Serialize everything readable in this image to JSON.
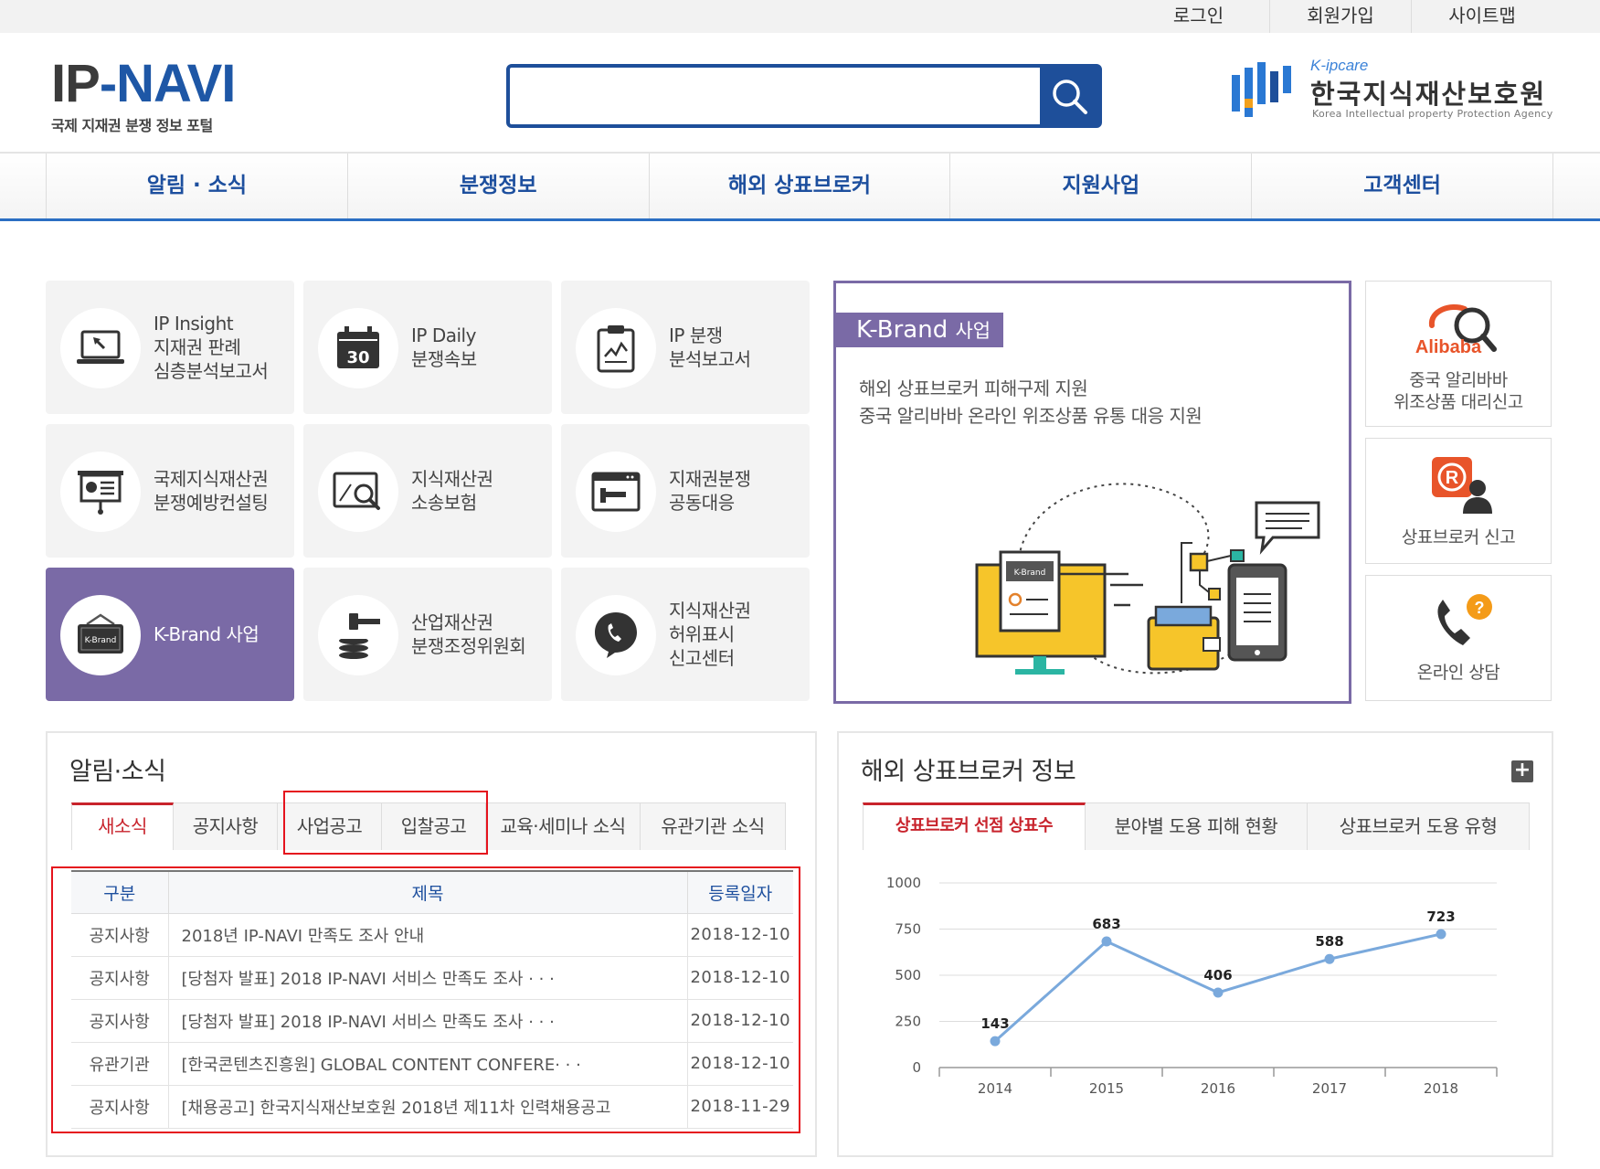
{
  "topbar": {
    "links": [
      "로그인",
      "회원가입",
      "사이트맵"
    ]
  },
  "logo": {
    "main_a": "IP",
    "main_b": "NAVI",
    "sub": "국제 지재권 분쟁 정보 포털"
  },
  "search": {
    "placeholder": "",
    "icon": "search-icon"
  },
  "agency": {
    "kip": "K-ipcare",
    "name": "한국지식재산보호원",
    "en": "Korea Intellectual property Protection Agency"
  },
  "nav": {
    "items": [
      "알림 · 소식",
      "분쟁정보",
      "해외 상표브로커",
      "지원사업",
      "고객센터"
    ]
  },
  "tiles": [
    {
      "label": "IP Insight\n지재권 판례\n심층분석보고서",
      "icon": "laptop-icon"
    },
    {
      "label": "IP Daily\n분쟁속보",
      "icon": "calendar-icon",
      "badge": "30"
    },
    {
      "label": "IP 분쟁\n분석보고서",
      "icon": "clipboard-chart-icon"
    },
    {
      "label": "국제지식재산권\n분쟁예방컨설팅",
      "icon": "presentation-board-icon"
    },
    {
      "label": "지식재산권\n소송보험",
      "icon": "magnifier-screen-icon"
    },
    {
      "label": "지재권분쟁\n공동대응",
      "icon": "browser-window-icon"
    },
    {
      "label": "K-Brand 사업",
      "icon": "k-brand-icon",
      "badge": "K-Brand",
      "active": true
    },
    {
      "label": "산업재산권\n분쟁조정위원회",
      "icon": "gavel-icon"
    },
    {
      "label": "지식재산권\n허위표시\n신고센터",
      "icon": "phone-bubble-icon"
    }
  ],
  "kbrand": {
    "title_a": "K-Brand",
    "title_b": "사업",
    "desc": "해외 상표브로커 피해구제 지원\n중국 알리바바 온라인 위조상품 유통 대응 지원",
    "illu_badge": "K-Brand"
  },
  "quick": [
    {
      "label": "중국 알리바바\n위조상품 대리신고",
      "icon": "alibaba-search-icon",
      "brand": "Alibaba"
    },
    {
      "label": "상표브로커 신고",
      "icon": "registered-person-icon"
    },
    {
      "label": "온라인 상담",
      "icon": "phone-question-icon"
    }
  ],
  "notices": {
    "title": "알림·소식",
    "tabs": [
      "새소식",
      "공지사항",
      "사업공고",
      "입찰공고",
      "교육·세미나 소식",
      "유관기관 소식"
    ],
    "active_tab": 0,
    "headers": [
      "구분",
      "제목",
      "등록일자"
    ],
    "rows": [
      {
        "cat": "공지사항",
        "title": "2018년 IP-NAVI 만족도 조사 안내",
        "date": "2018-12-10"
      },
      {
        "cat": "공지사항",
        "title": "[당첨자 발표] 2018 IP-NAVI 서비스 만족도 조사 · · ·",
        "date": "2018-12-10"
      },
      {
        "cat": "공지사항",
        "title": "[당첨자 발표] 2018 IP-NAVI 서비스 만족도 조사 · · ·",
        "date": "2018-12-10"
      },
      {
        "cat": "유관기관",
        "title": "[한국콘텐츠진흥원] GLOBAL CONTENT CONFERE· · ·",
        "date": "2018-12-10"
      },
      {
        "cat": "공지사항",
        "title": "[채용공고] 한국지식재산보호원 2018년 제11차 인력채용공고",
        "date": "2018-11-29"
      }
    ]
  },
  "broker": {
    "title": "해외 상표브로커 정보",
    "more": "+",
    "tabs": [
      "상표브로커 선점 상표수",
      "분야별 도용 피해 현황",
      "상표브로커 도용 유형"
    ],
    "active_tab": 0
  },
  "chart_data": {
    "type": "line",
    "x": [
      "2014",
      "2015",
      "2016",
      "2017",
      "2018"
    ],
    "values": [
      143,
      683,
      406,
      588,
      723
    ],
    "ylim": [
      0,
      1000
    ],
    "yticks": [
      0,
      250,
      500,
      750,
      1000
    ],
    "grid": true,
    "color": "#7aa9dc"
  },
  "colors": {
    "brand_blue": "#1e4f9a",
    "nav_blue": "#1d4f9e",
    "purple": "#7a6aa6",
    "red": "#c8232c"
  }
}
